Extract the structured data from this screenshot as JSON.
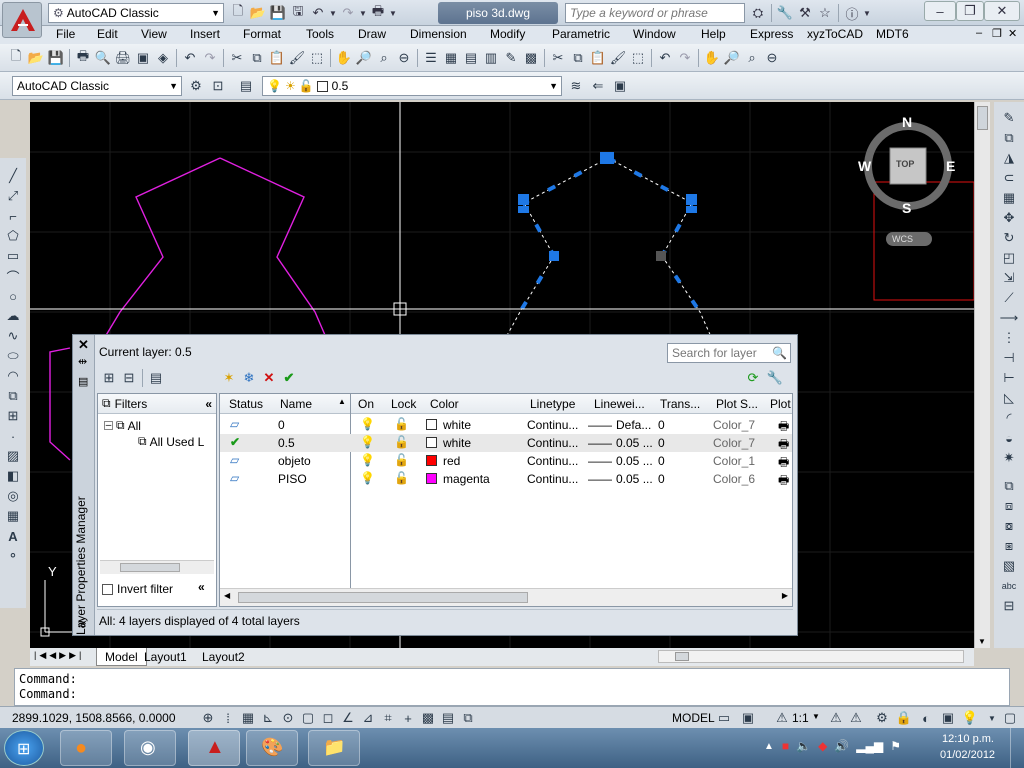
{
  "titlebar": {
    "workspace": "AutoCAD Classic",
    "file_name": "piso 3d.dwg",
    "search_placeholder": "Type a keyword or phrase"
  },
  "menu": [
    "File",
    "Edit",
    "View",
    "Insert",
    "Format",
    "Tools",
    "Draw",
    "Dimension",
    "Modify",
    "Parametric",
    "Window",
    "Help",
    "Express",
    "xyzToCAD",
    "MDT6"
  ],
  "toolbar2": {
    "workspace": "AutoCAD Classic",
    "layer": "0.5"
  },
  "viewcube": {
    "n": "N",
    "s": "S",
    "e": "E",
    "w": "W",
    "face": "TOP",
    "ucs": "WCS"
  },
  "ucs_icon": {
    "y": "Y"
  },
  "layer_manager": {
    "side_title": "Layer Properties Manager",
    "current_layer": "Current layer: 0.5",
    "search_placeholder": "Search for layer",
    "filters_label": "Filters",
    "tree": [
      "All",
      "All Used L"
    ],
    "invert_filter": "Invert filter",
    "columns": [
      "Status",
      "Name",
      "On",
      "Lock",
      "Color",
      "Linetype",
      "Linewei...",
      "Trans...",
      "Plot S...",
      "Plot"
    ],
    "rows": [
      {
        "name": "0",
        "color_name": "white",
        "color": "#ffffff",
        "linetype": "Continu...",
        "lineweight": "Defa...",
        "trans": "0",
        "plot_style": "Color_7",
        "current": false
      },
      {
        "name": "0.5",
        "color_name": "white",
        "color": "#ffffff",
        "linetype": "Continu...",
        "lineweight": "0.05 ...",
        "trans": "0",
        "plot_style": "Color_7",
        "current": true
      },
      {
        "name": "objeto",
        "color_name": "red",
        "color": "#ff0000",
        "linetype": "Continu...",
        "lineweight": "0.05 ...",
        "trans": "0",
        "plot_style": "Color_1",
        "current": false
      },
      {
        "name": "PISO",
        "color_name": "magenta",
        "color": "#ff00ff",
        "linetype": "Continu...",
        "lineweight": "0.05 ...",
        "trans": "0",
        "plot_style": "Color_6",
        "current": false
      }
    ],
    "status_line": "All: 4 layers displayed of 4 total layers"
  },
  "tabs": [
    "Model",
    "Layout1",
    "Layout2"
  ],
  "command_lines": [
    "Command:",
    "Command:"
  ],
  "status": {
    "coords": "2899.1029, 1508.8566, 0.0000",
    "model": "MODEL",
    "scale": "1:1"
  },
  "clock": {
    "time": "12:10 p.m.",
    "date": "01/02/2012"
  }
}
